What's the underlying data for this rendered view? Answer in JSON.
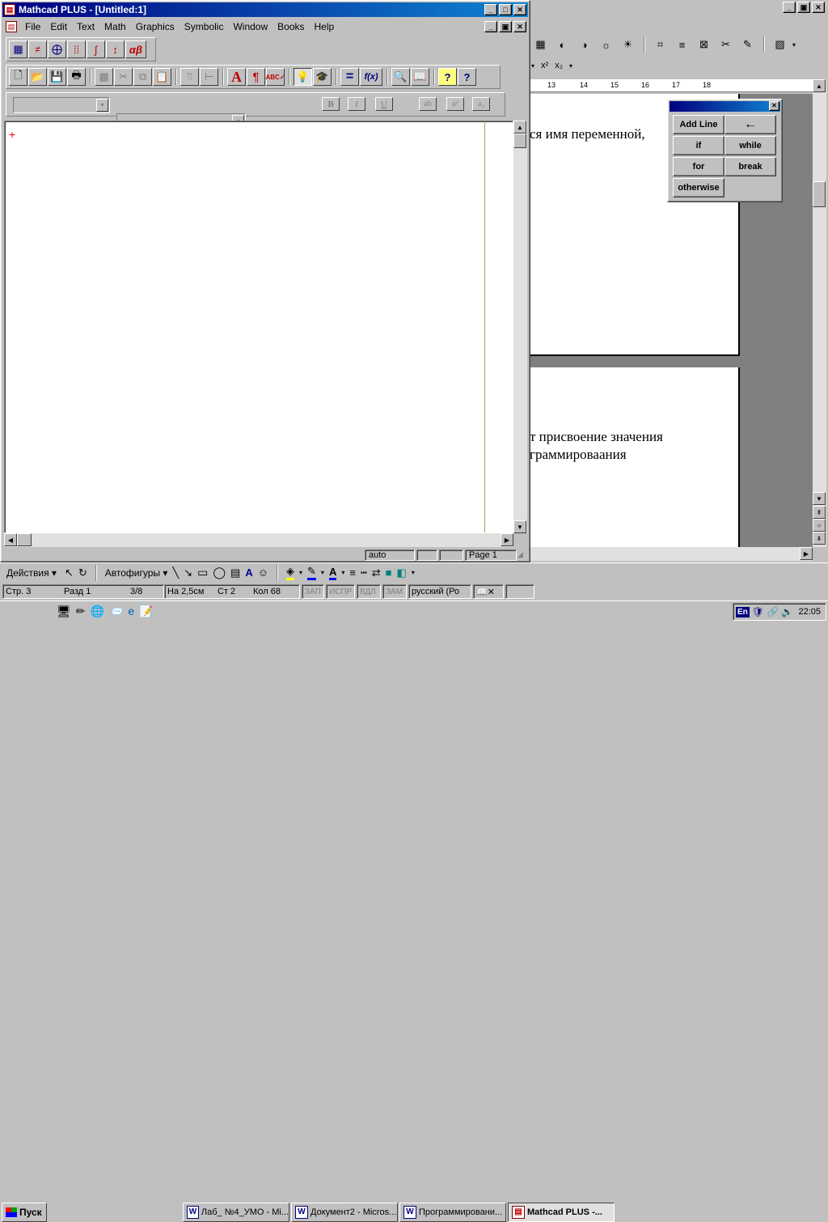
{
  "mathcad": {
    "title": "Mathcad PLUS - [Untitled:1]",
    "menu": [
      "File",
      "Edit",
      "Text",
      "Math",
      "Graphics",
      "Symbolic",
      "Window",
      "Books",
      "Help"
    ],
    "palette_greek": "αβ",
    "formula_fx": "f(x)",
    "format_buttons": [
      "B",
      "I",
      "U"
    ],
    "sub_buttons": [
      "ab",
      "a²",
      "a₂"
    ],
    "status_mode": "auto",
    "status_page": "Page 1"
  },
  "word": {
    "ruler_marks": [
      "13",
      "14",
      "15",
      "16",
      "17",
      "18"
    ],
    "text_line1": "ся  имя  переменной,",
    "text_line2": "т присвоение значения",
    "text_line3": "граммироваания",
    "superscript": "x²",
    "subscript": "x₂",
    "status": {
      "page": "Стр.  3",
      "section": "Разд  1",
      "pages": "3/8",
      "at": "На 2,5см",
      "line": "Ст  2",
      "col": "Кол  68",
      "rec": "ЗАП",
      "trk": "ИСПР",
      "ext": "ВДЛ",
      "ovr": "ЗАМ",
      "lang": "русский (Ро"
    },
    "drawing": {
      "actions": "Действия",
      "autoshapes": "Автофигуры"
    }
  },
  "programming_palette": {
    "buttons": [
      "Add Line",
      "←",
      "if",
      "while",
      "for",
      "break",
      "otherwise"
    ]
  },
  "taskbar": {
    "start": "Пуск",
    "tasks": [
      "Лаб_ №4_УМО - Mi...",
      "Документ2 - Micros...",
      "Программировани...",
      "Mathcad PLUS -..."
    ],
    "lang": "En",
    "time": "22:05"
  }
}
